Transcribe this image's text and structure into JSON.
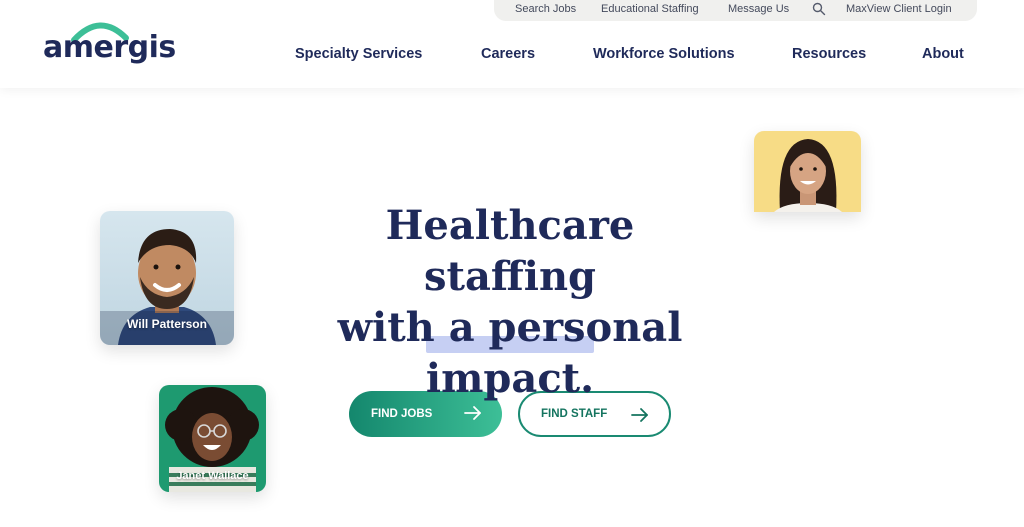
{
  "brand": {
    "logo_text": "amergis",
    "accent": "#1f2a5a",
    "arc_color": "#3dbf97"
  },
  "utility_nav": {
    "search_jobs": "Search Jobs",
    "educational_staffing": "Educational Staffing",
    "message_us": "Message Us",
    "search_icon": "search-icon",
    "client_login": "MaxView Client Login"
  },
  "main_nav": {
    "specialty_services": "Specialty Services",
    "careers": "Careers",
    "workforce_solutions": "Workforce Solutions",
    "resources": "Resources",
    "about": "About"
  },
  "hero": {
    "title_line1": "Healthcare staffing",
    "title_line2": "with a personal",
    "title_line3": "impact.",
    "highlight_color": "#c6cff3"
  },
  "buttons": {
    "find_jobs": "FIND JOBS",
    "find_staff": "FIND STAFF",
    "primary_gradient": [
      "#14876d",
      "#3dbf97"
    ]
  },
  "cards": {
    "will": {
      "name": "Will Patterson"
    },
    "janet": {
      "name": "Janet Wallace"
    },
    "woman": {
      "name": ""
    }
  }
}
